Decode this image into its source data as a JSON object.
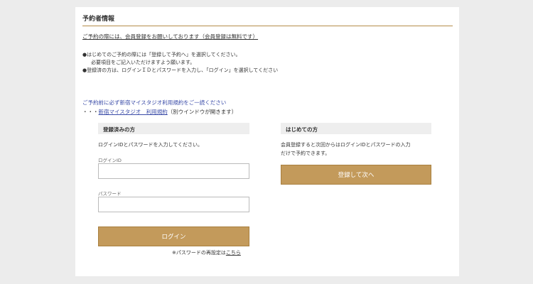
{
  "header": {
    "title": "予約者情報"
  },
  "notice": {
    "member_text": "ご予約の際には、会員登録をお願いしております（会員登録は無料です）"
  },
  "notes": {
    "line1": "●はじめてのご予約の際には「登録して予約へ」を選択してください。",
    "line2": "必要項目をご記入いただけますよう願います。",
    "line3": "●登録済の方は、ログインＩＤとパスワードを入力し、「ログイン」を選択してください"
  },
  "terms": {
    "notice": "ご予約前に必ず新宿マイスタジオ利用規約をご一読ください",
    "prefix": "・・・",
    "link": "新宿マイスタジオ　利用規約",
    "suffix": "（別ウインドウが開きます）"
  },
  "login": {
    "header": "登録済みの方",
    "instruction": "ログインIDとパスワードを入力してください。",
    "id_label": "ログインID",
    "password_label": "パスワード",
    "button_label": "ログイン",
    "reset_text": "※パスワードの再設定は",
    "reset_link": "こちら"
  },
  "register": {
    "header": "はじめての方",
    "description_line1": "会員登録すると次回からはログインIDとパスワードの入力",
    "description_line2": "だけで予約できます。",
    "button_label": "登録して次へ"
  },
  "colors": {
    "accent": "#c39a5b",
    "rule": "#b58d4a",
    "link": "#3b4ca8",
    "page_bg": "#ececec"
  }
}
